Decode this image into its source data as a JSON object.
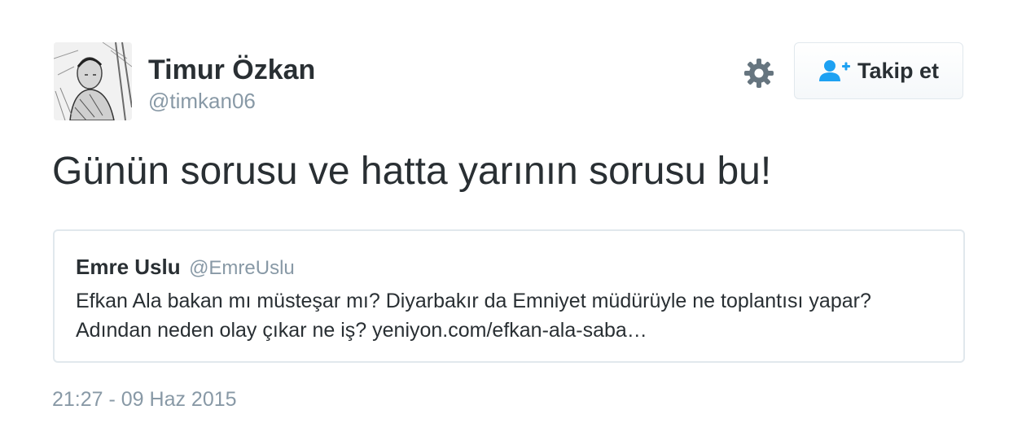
{
  "author": {
    "name": "Timur Özkan",
    "handle": "@timkan06"
  },
  "actions": {
    "settings_icon": "gear-icon",
    "follow_label": "Takip et",
    "follow_icon": "add-user-icon"
  },
  "tweet": {
    "text": "Günün sorusu ve hatta yarının sorusu bu!",
    "timestamp": "21:27 - 09 Haz 2015"
  },
  "quoted_tweet": {
    "name": "Emre Uslu",
    "handle": "@EmreUslu",
    "text": "Efkan Ala bakan mı müsteşar mı? Diyarbakır da Emniyet müdürüyle ne toplantısı yapar? Adından neden olay çıkar ne iş? yeniyon.com/efkan-ala-saba…"
  },
  "colors": {
    "text": "#292f33",
    "secondary": "#8899a6",
    "accent": "#1da1f2",
    "border": "#e1e8ed"
  }
}
